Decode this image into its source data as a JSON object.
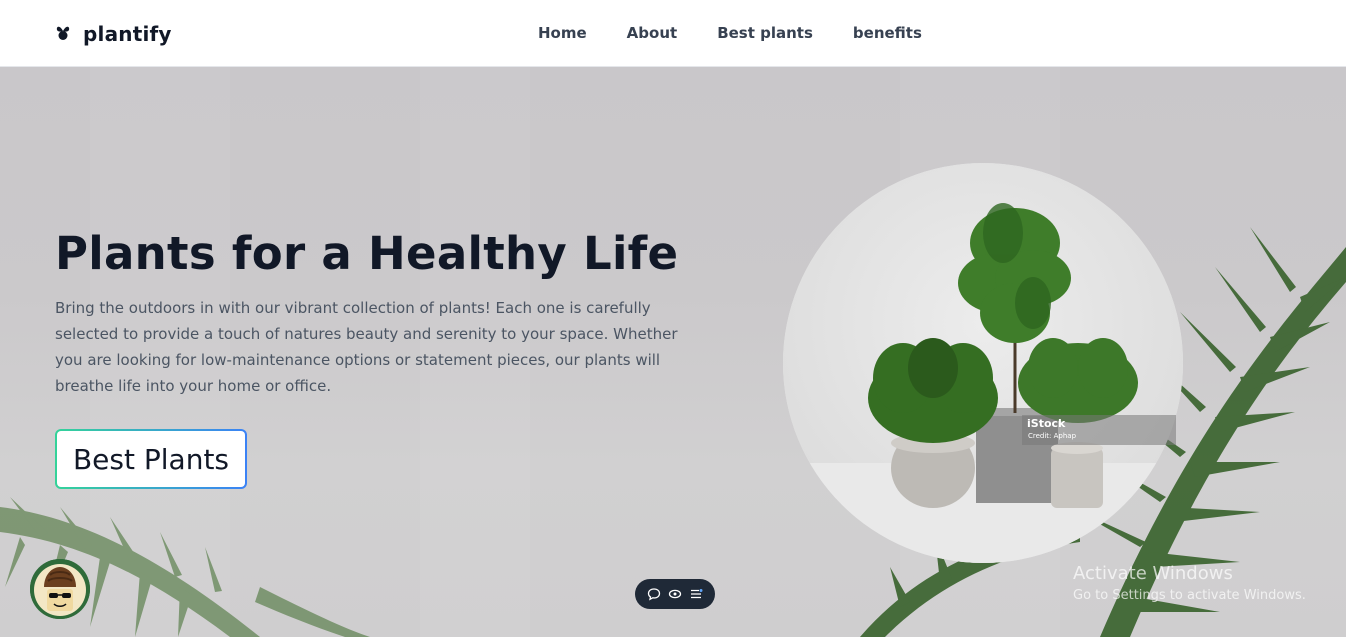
{
  "brand": {
    "name": "plantify",
    "icon": "plant-logo-icon"
  },
  "nav": {
    "links": [
      "Home",
      "About",
      "Best plants",
      "benefits"
    ]
  },
  "hero": {
    "title": "Plants for a Healthy Life",
    "description": "Bring the outdoors in with our vibrant collection of plants! Each one is carefully selected to provide a touch of natures beauty and serenity to your space. Whether you are looking for low-maintenance options or statement pieces, our plants will breathe life into your home or office.",
    "cta_label": "Best Plants"
  },
  "image_badge": {
    "name": "iStock",
    "credit": "Credit: Aphap"
  },
  "windows_watermark": {
    "title": "Activate Windows",
    "subtitle": "Go to Settings to activate Windows."
  },
  "toolbar": {
    "icons": [
      "comment-icon",
      "eye-icon",
      "menu-icon"
    ]
  },
  "colors": {
    "accent_from": "#34d399",
    "accent_to": "#3b82f6",
    "text_dark": "#111827"
  }
}
